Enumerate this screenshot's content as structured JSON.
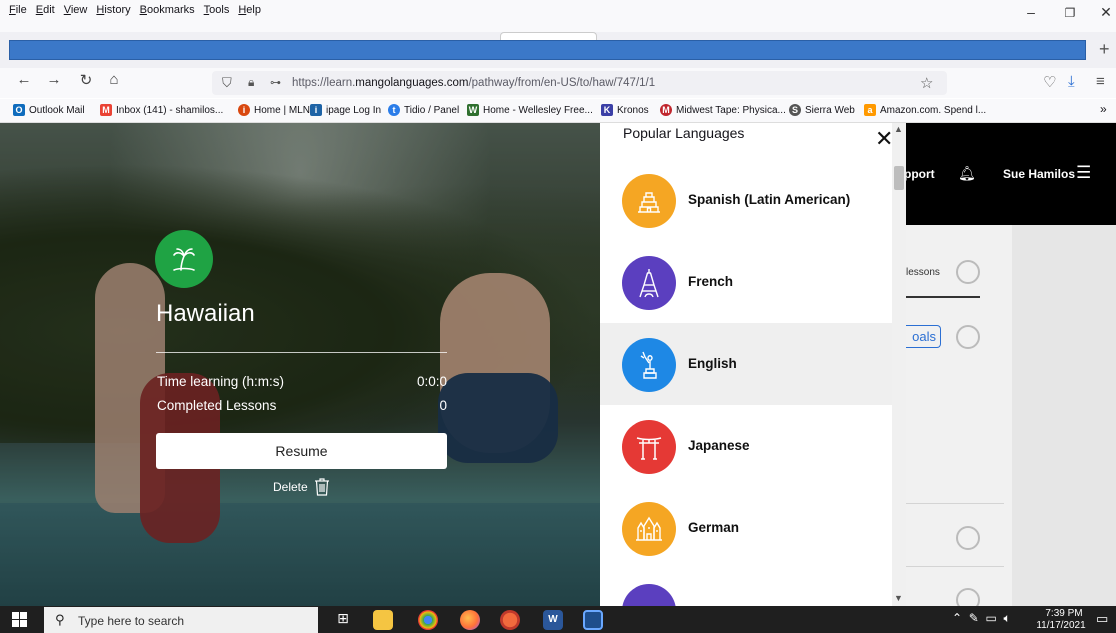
{
  "browser": {
    "menu": [
      "File",
      "Edit",
      "View",
      "History",
      "Bookmarks",
      "Tools",
      "Help"
    ],
    "url_prefix": "https://learn.",
    "url_domain": "mangolanguages.com",
    "url_path": "/pathway/from/en-US/to/haw/747/1/1",
    "bookmarks": [
      {
        "label": "Outlook Mail",
        "color": "#0f6cbd",
        "glyph": "O"
      },
      {
        "label": "Inbox (141) - shamilos...",
        "color": "#ea4335",
        "glyph": "M"
      },
      {
        "label": "Home | MLN",
        "color": "#d9480f",
        "glyph": "i"
      },
      {
        "label": "ipage Log In",
        "color": "#1e63a6",
        "glyph": "i"
      },
      {
        "label": "Tidio / Panel",
        "color": "#2b7de9",
        "glyph": "t"
      },
      {
        "label": "Home - Wellesley Free...",
        "color": "#2f6f2f",
        "glyph": "W"
      },
      {
        "label": "Kronos",
        "color": "#3b3fa6",
        "glyph": "K"
      },
      {
        "label": "Midwest Tape: Physica...",
        "color": "#c0262d",
        "glyph": "M"
      },
      {
        "label": "Sierra Web",
        "color": "#555555",
        "glyph": "S"
      },
      {
        "label": "Amazon.com. Spend l...",
        "color": "#ff9900",
        "glyph": "a"
      }
    ]
  },
  "course": {
    "language": "Hawaiian",
    "badge_color": "#1fa344",
    "stats": [
      {
        "label": "Time learning (h:m:s)",
        "value": "0:0:0"
      },
      {
        "label": "Completed Lessons",
        "value": "0"
      }
    ],
    "resume_label": "Resume",
    "delete_label": "Delete"
  },
  "header": {
    "support_label": "pport",
    "user_name": "Sue Hamilos"
  },
  "behind": {
    "lessons_tab": "lessons",
    "goals_label": "oals"
  },
  "language_picker": {
    "title": "Popular Languages",
    "languages": [
      {
        "name": "Spanish (Latin American)",
        "color": "#f5a623",
        "icon": "pyramid-icon"
      },
      {
        "name": "French",
        "color": "#5b3fbf",
        "icon": "eiffel-tower-icon"
      },
      {
        "name": "English",
        "color": "#1e88e5",
        "icon": "statue-of-liberty-icon",
        "selected": true
      },
      {
        "name": "Japanese",
        "color": "#e53935",
        "icon": "torii-gate-icon"
      },
      {
        "name": "German",
        "color": "#f5a623",
        "icon": "castle-icon"
      },
      {
        "name": "",
        "color": "#5b3fbf",
        "icon": "language-icon"
      }
    ]
  },
  "taskbar": {
    "search_placeholder": "Type here to search",
    "time": "7:39 PM",
    "date": "11/17/2021"
  }
}
